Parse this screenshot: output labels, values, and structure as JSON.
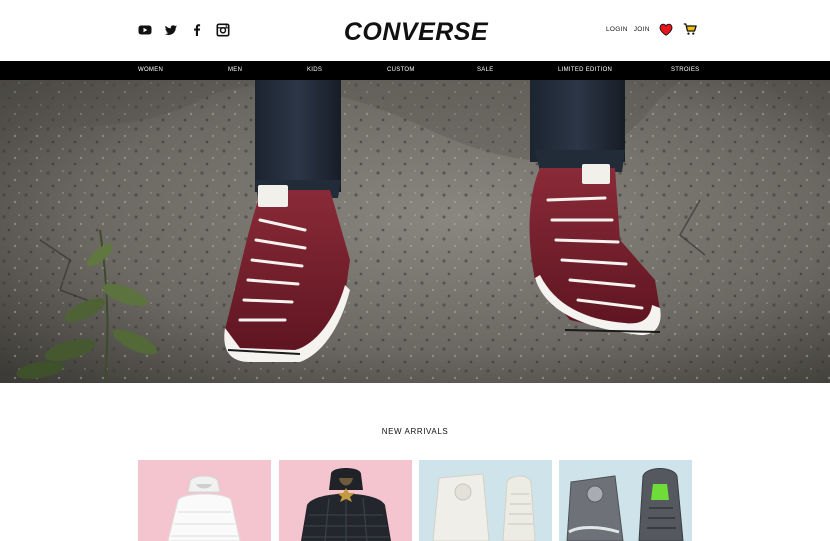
{
  "header": {
    "brand": "CONVERSE",
    "social": [
      {
        "icon": "youtube-icon"
      },
      {
        "icon": "twitter-icon"
      },
      {
        "icon": "facebook-icon"
      },
      {
        "icon": "instagram-icon"
      }
    ],
    "login_label": "LOGIN",
    "join_label": "JOIN",
    "wishlist_icon": "heart-icon",
    "cart_icon": "cart-icon"
  },
  "nav": {
    "items": [
      "WOMEN",
      "MEN",
      "KIDS",
      "CUSTOM",
      "SALE",
      "LIMITED EDITION",
      "STROIES"
    ]
  },
  "hero": {
    "image": "red-chuck-taylor-sneakers-against-concrete-wall"
  },
  "new_arrivals": {
    "title": "NEW ARRIVALS",
    "products": [
      {
        "image": "white-puffer-jacket",
        "background": "#f4c4cf"
      },
      {
        "image": "black-quilted-puffer-jacket",
        "background": "#f4c4cf"
      },
      {
        "image": "cream-high-top-sneakers",
        "background": "#cfe3ea"
      },
      {
        "image": "grey-high-top-sneakers",
        "background": "#cfe3ea"
      }
    ]
  },
  "colors": {
    "nav_background": "#000000",
    "accent_heart": "#e8141c",
    "card_pink": "#f4c4cf",
    "card_blue": "#cfe3ea"
  }
}
